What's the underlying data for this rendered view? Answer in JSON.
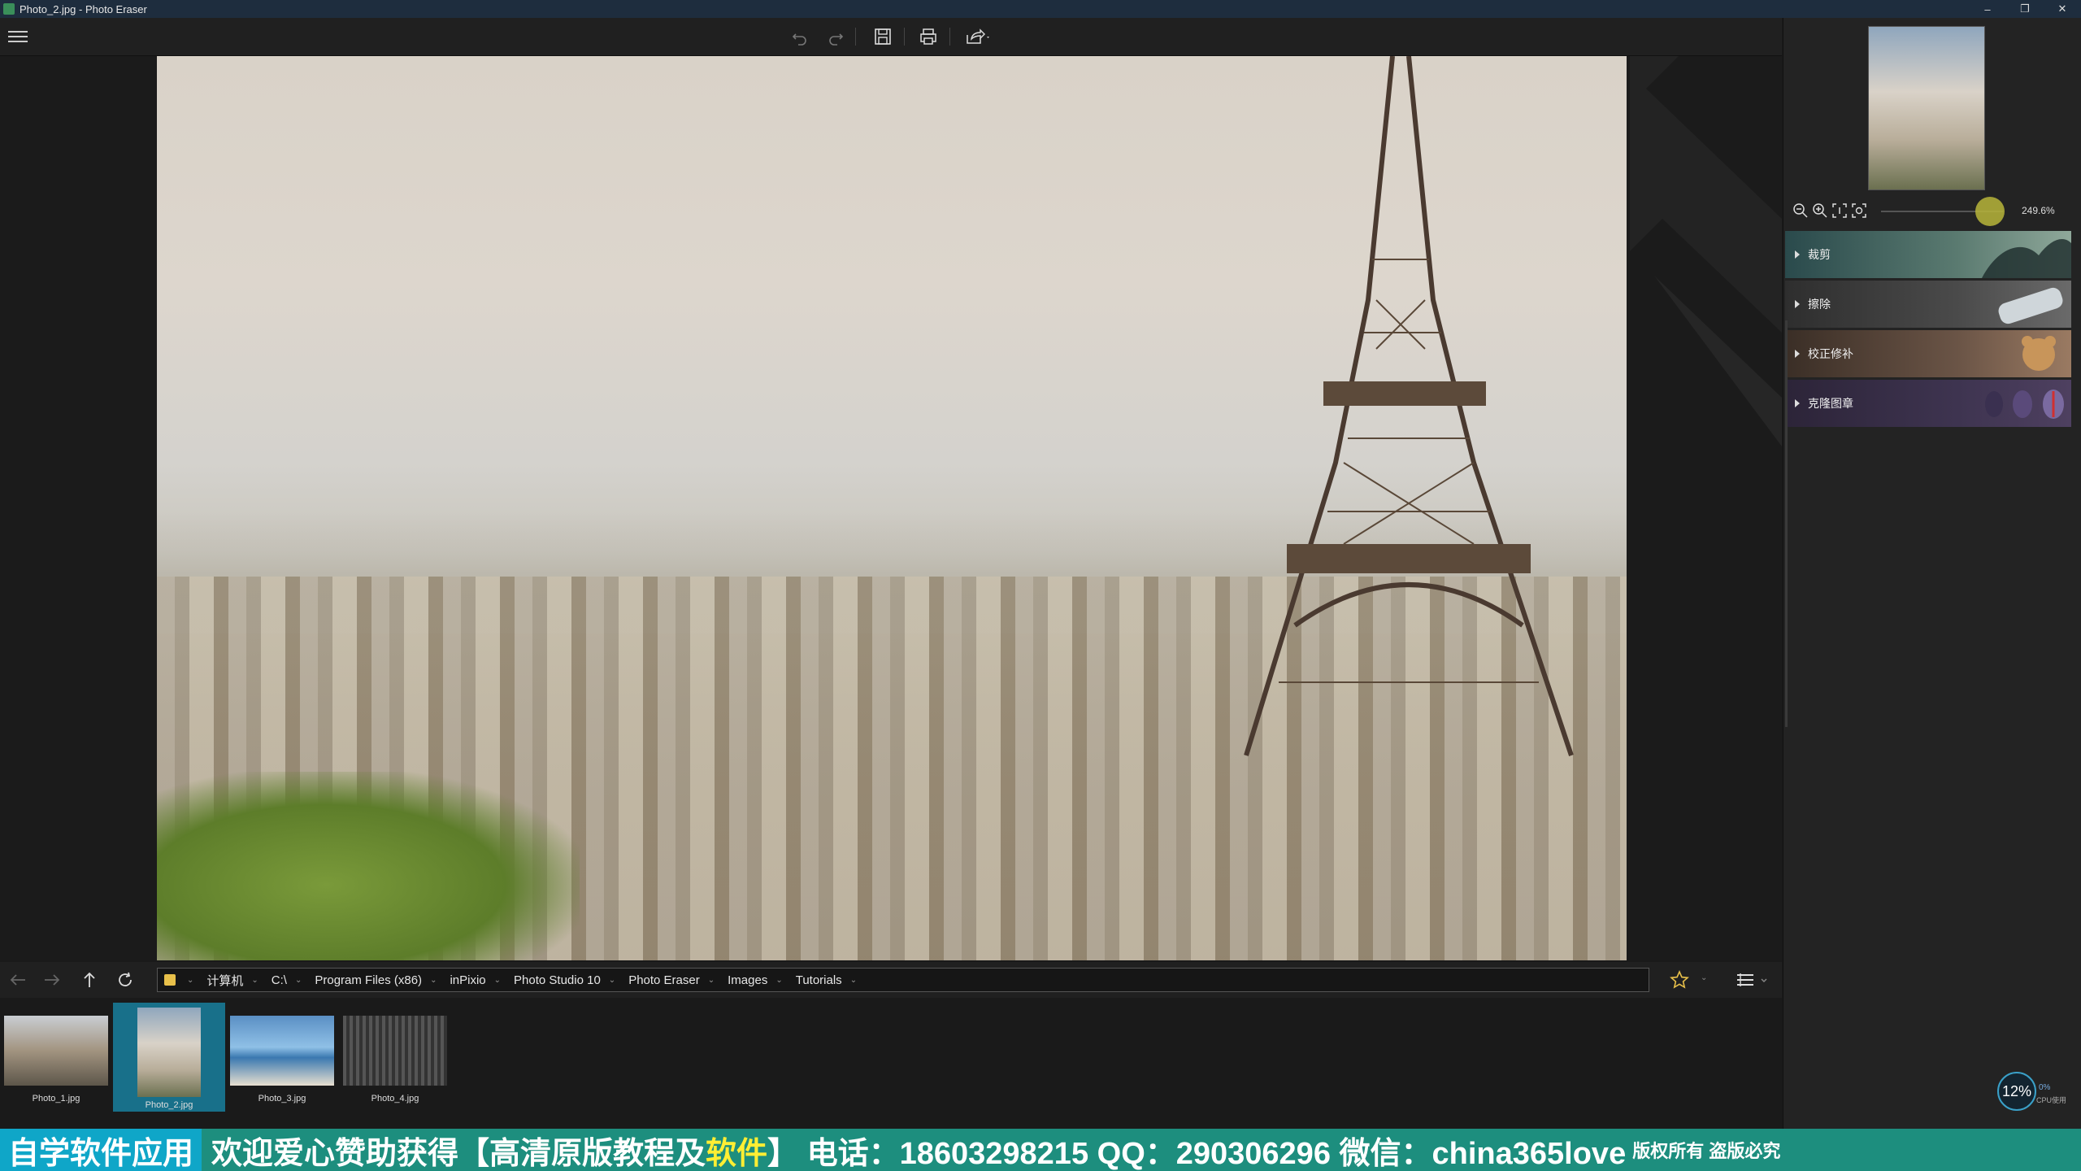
{
  "window": {
    "title": "Photo_2.jpg - Photo Eraser",
    "controls": {
      "minimize": "–",
      "restore": "❐",
      "close": "✕"
    }
  },
  "toolbar": {
    "icons": [
      "menu-icon",
      "undo-icon",
      "redo-icon",
      "save-icon",
      "print-icon",
      "share-icon"
    ]
  },
  "breadcrumb": {
    "items": [
      "计算机",
      "C:\\",
      "Program Files (x86)",
      "inPixio",
      "Photo Studio 10",
      "Photo Eraser",
      "Images",
      "Tutorials"
    ]
  },
  "filmstrip": {
    "items": [
      {
        "label": "Photo_1.jpg",
        "selected": false
      },
      {
        "label": "Photo_2.jpg",
        "selected": true
      },
      {
        "label": "Photo_3.jpg",
        "selected": false
      },
      {
        "label": "Photo_4.jpg",
        "selected": false
      }
    ]
  },
  "panel": {
    "zoom_value": "249.6%",
    "tools": [
      "裁剪",
      "擦除",
      "校正修补",
      "克隆图章"
    ]
  },
  "status": {
    "cpu_percent": "12%",
    "cpu_small": "0%",
    "cpu_label": "CPU使用"
  },
  "banner": {
    "left": "自学软件应用",
    "main_1": "欢迎爱心赞助获得【高清原版教程及",
    "main_hl": "软件",
    "main_2": "】 电话：18603298215 QQ：290306296 微信：china365love",
    "right": "版权所有 盗版必究"
  },
  "colors": {
    "selected_thumb": "#18708a",
    "banner_bg": "#1d8e7e",
    "zoom_knob": "#b7b53a"
  }
}
